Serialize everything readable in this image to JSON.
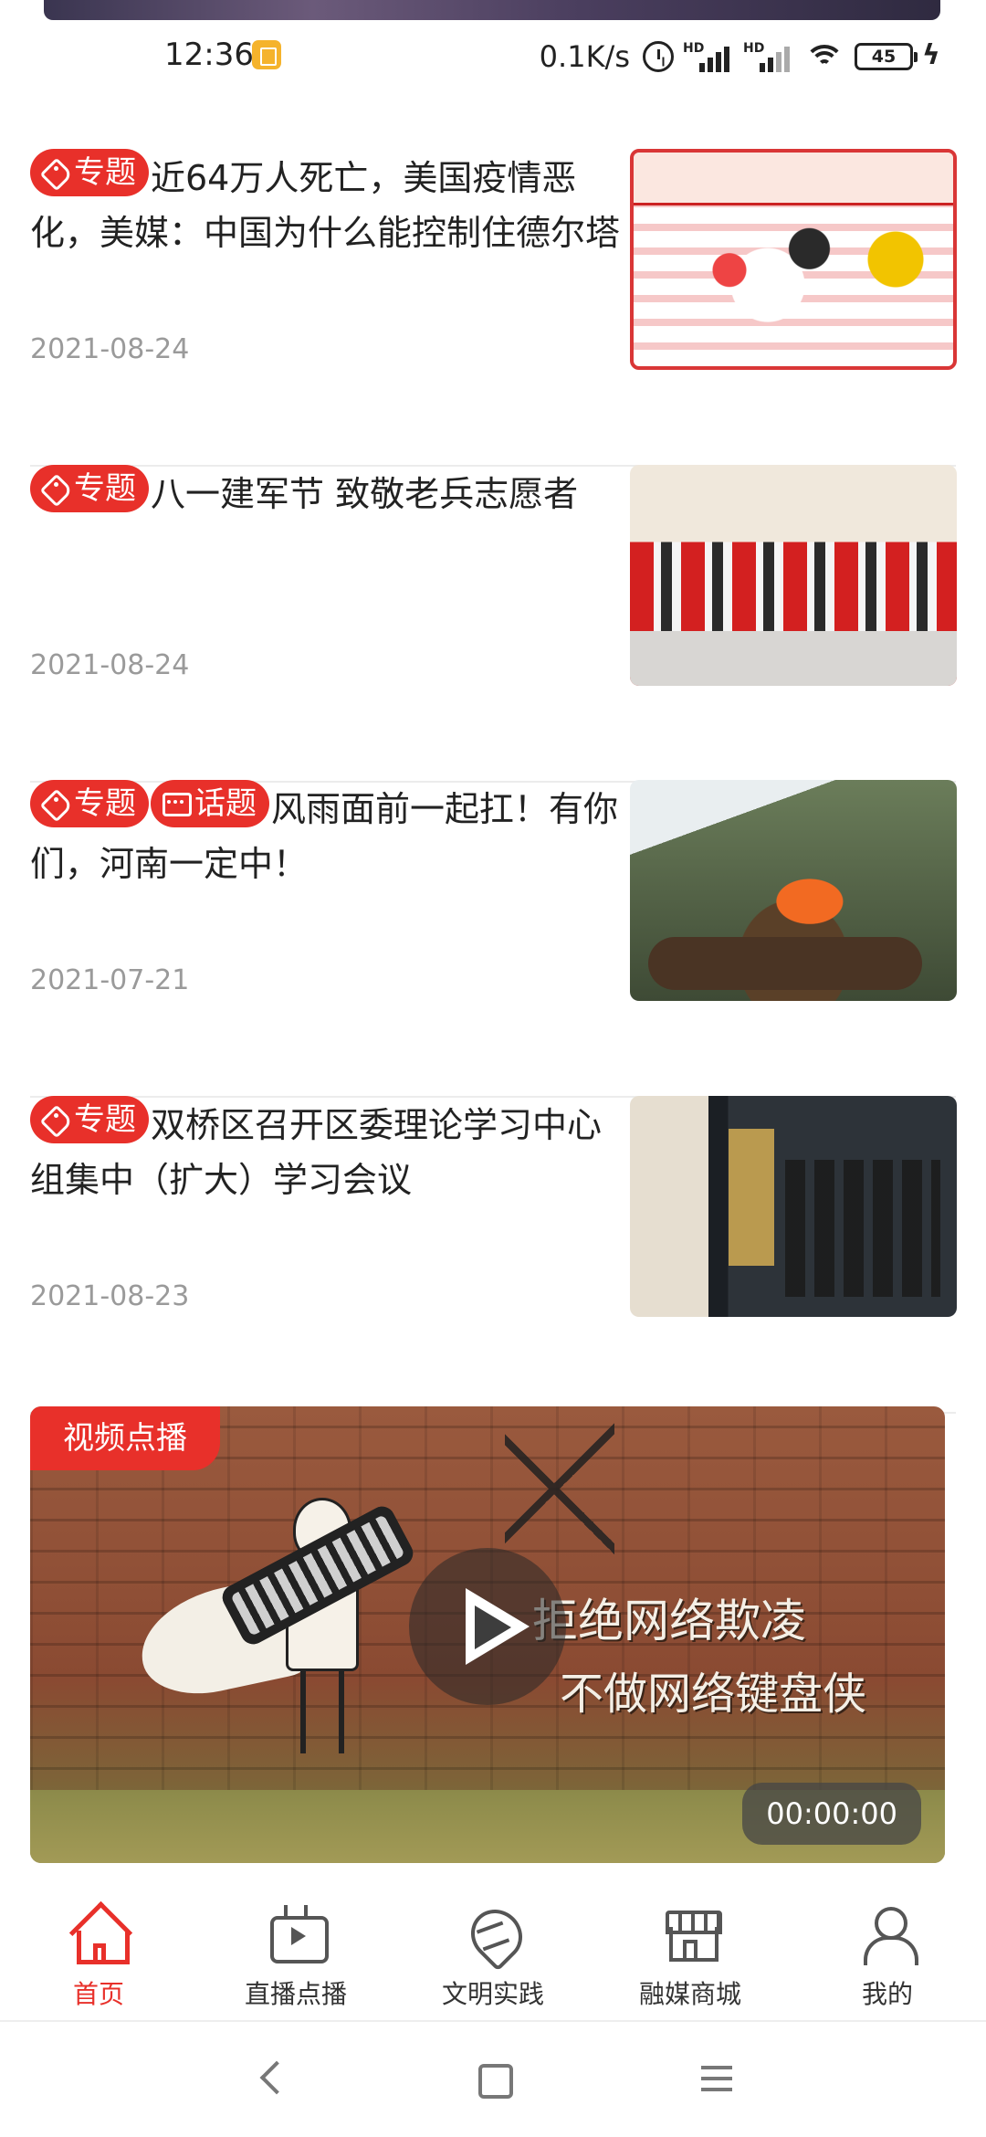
{
  "status_bar": {
    "time": "12:36",
    "net_speed": "0.1K/s",
    "battery_level": "45",
    "icons": [
      "app-notification-icon",
      "alarm-icon",
      "signal-icon",
      "wifi-icon",
      "battery-icon",
      "charging-icon"
    ]
  },
  "news": [
    {
      "badges": [
        "专题"
      ],
      "title": "近64万人死亡，美国疫情恶化，美媒：中国为什么能控制住德尔塔",
      "date": "2021-08-24"
    },
    {
      "badges": [
        "专题"
      ],
      "title": "八一建军节 致敬老兵志愿者",
      "date": "2021-08-24"
    },
    {
      "badges": [
        "专题",
        "话题"
      ],
      "title": "风雨面前一起扛！有你们，河南一定中！",
      "date": "2021-07-21"
    },
    {
      "badges": [
        "专题"
      ],
      "title": "双桥区召开区委理论学习中心组集中（扩大）学习会议",
      "date": "2021-08-23"
    }
  ],
  "video": {
    "tag": "视频点播",
    "graffiti_line1": "拒绝网络欺凌",
    "graffiti_line2": "不做网络键盘侠",
    "duration": "00:00:00"
  },
  "tabs": [
    {
      "label": "首页",
      "icon": "home-icon",
      "active": true
    },
    {
      "label": "直播点播",
      "icon": "tv-icon",
      "active": false
    },
    {
      "label": "文明实践",
      "icon": "heart-hands-icon",
      "active": false
    },
    {
      "label": "融媒商城",
      "icon": "shop-icon",
      "active": false
    },
    {
      "label": "我的",
      "icon": "user-icon",
      "active": false
    }
  ],
  "colors": {
    "accent": "#e8302a",
    "date_text": "#9a9a9a",
    "divider": "#ececec"
  }
}
